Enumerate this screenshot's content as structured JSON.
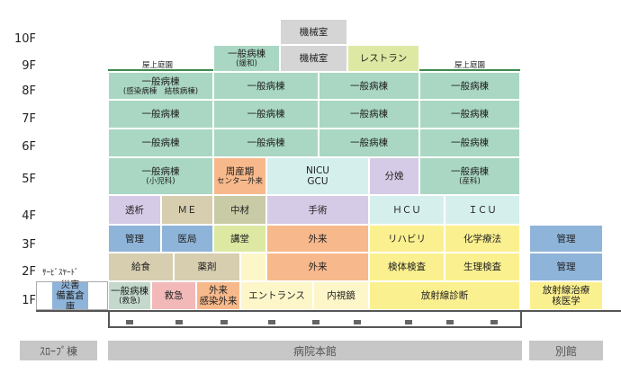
{
  "floors": [
    "10F",
    "9F",
    "8F",
    "7F",
    "6F",
    "5F",
    "4F",
    "3F",
    "2F",
    "1F"
  ],
  "rooms": {
    "kikaishitsu_10": "機械室",
    "kikaishitsu_9": "機械室",
    "restaurant": "レストラン",
    "ippan_kanwa": "一般病棟",
    "ippan_kanwa_sub": "(緩和)",
    "okujo_left": "屋上庭園",
    "okujo_right": "屋上庭園",
    "f8_1": "一般病棟",
    "f8_1_sub": "(感染病棟　結核病棟)",
    "f8_2": "一般病棟",
    "f8_3": "一般病棟",
    "f8_4": "一般病棟",
    "f7_1": "一般病棟",
    "f7_2": "一般病棟",
    "f7_3": "一般病棟",
    "f7_4": "一般病棟",
    "f6_1": "一般病棟",
    "f6_2": "一般病棟",
    "f6_3": "一般病棟",
    "f6_4": "一般病棟",
    "f5_ped": "一般病棟",
    "f5_ped_sub": "(小児科)",
    "f5_perinatal": "周産期",
    "f5_perinatal_2": "センター外来",
    "f5_nicu": "NICU",
    "f5_gcu": "GCU",
    "f5_bunben": "分娩",
    "f5_obst": "一般病棟",
    "f5_obst_sub": "(産科)",
    "f4_touseki": "透析",
    "f4_me": "ＭＥ",
    "f4_chuzai": "中材",
    "f4_shujutsu": "手術",
    "f4_hcu": "ＨＣＵ",
    "f4_icu": "ＩＣＵ",
    "f3_kanri": "管理",
    "f3_iyaku": "医局",
    "f3_kodo": "講堂",
    "f3_gairai": "外来",
    "f3_rehab": "リハビリ",
    "f3_chemo": "化学療法",
    "f3_annex_kanri": "管理",
    "f2_kyushoku": "給食",
    "f2_yakuzai": "薬剤",
    "f2_gairai": "外来",
    "f2_kentai": "検体検査",
    "f2_seiri": "生理検査",
    "f2_annex_kanri": "管理",
    "f2_service": "ｻｰﾋﾞｽﾔｰﾄﾞ",
    "f1_saigai": "災害",
    "f1_saigai_2": "備蓄倉庫",
    "f1_ippan": "一般病棟",
    "f1_ippan_sub": "(救急)",
    "f1_kyukyu": "救急",
    "f1_gairai": "外来",
    "f1_gairai_2": "感染外来",
    "f1_entrance": "エントランス",
    "f1_naishikyo": "内視鏡",
    "f1_hoshasen": "放射線診断",
    "f1_annex_1": "放射線治療",
    "f1_annex_2": "核医学"
  },
  "buildings": {
    "slope": "ｽﾛｰﾌﾟ棟",
    "main": "病院本館",
    "annex": "別館"
  }
}
